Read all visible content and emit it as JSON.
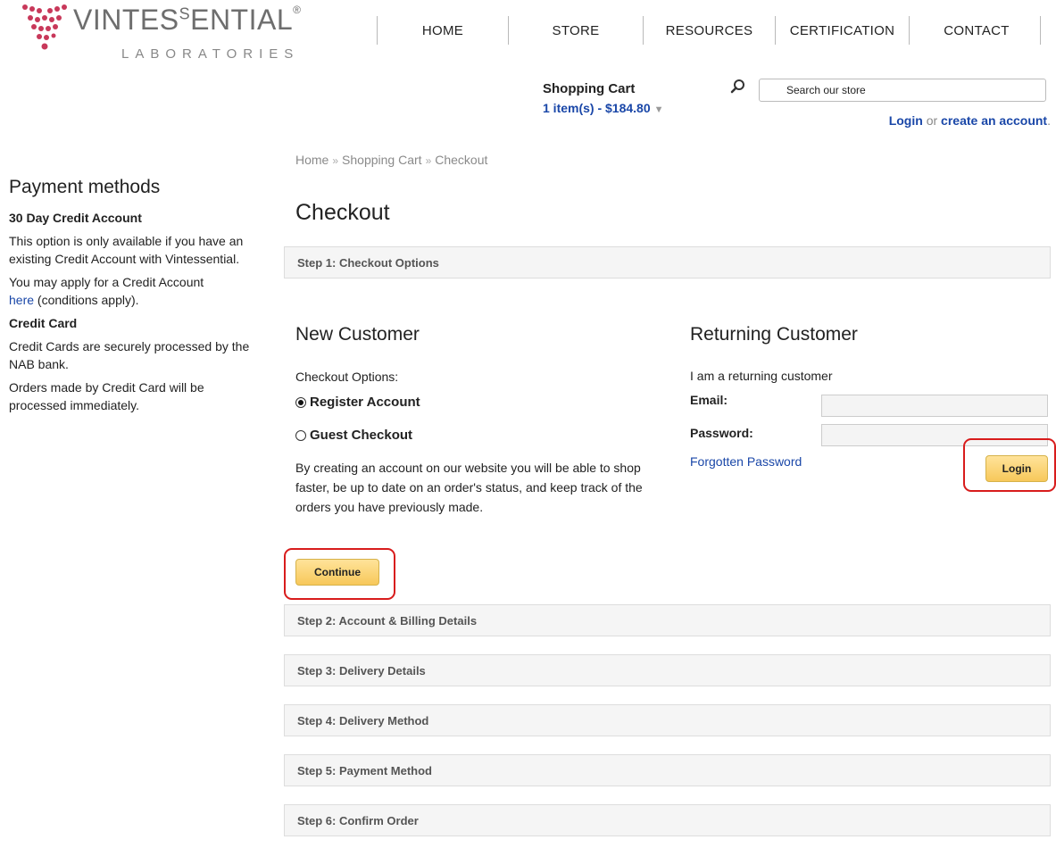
{
  "header": {
    "logo": {
      "word_part1": "VINTES",
      "word_sup": "S",
      "word_part2": "ENTIAL",
      "registered": "®",
      "subtitle": "LABORATORIES"
    },
    "nav": [
      "HOME",
      "STORE",
      "RESOURCES",
      "CERTIFICATION",
      "CONTACT"
    ],
    "cart": {
      "title": "Shopping Cart",
      "summary": "1 item(s) - $184.80",
      "caret": "▼"
    },
    "search": {
      "placeholder": "Search our store"
    },
    "account": {
      "login": "Login",
      "or": "or",
      "create": "create an account",
      "period": "."
    }
  },
  "breadcrumb": [
    "Home",
    "Shopping Cart",
    "Checkout"
  ],
  "breadcrumb_sep": "»",
  "sidebar": {
    "title": "Payment methods",
    "credit_title": "30 Day Credit Account",
    "credit_text": "This option is only available if you have an existing Credit Account with Vintessential.",
    "apply_text_prefix": "You may apply for a Credit Account",
    "apply_link": "here",
    "apply_text_suffix": "(conditions apply).",
    "card_title": "Credit Card",
    "card_text_1": "Credit Cards are securely processed by the NAB bank.",
    "card_text_2": "Orders made by Credit Card will be processed immediately."
  },
  "main": {
    "title": "Checkout",
    "steps": [
      "Step 1: Checkout Options",
      "Step 2: Account & Billing Details",
      "Step 3: Delivery Details",
      "Step 4: Delivery Method",
      "Step 5: Payment Method",
      "Step 6: Confirm Order"
    ],
    "new_customer": {
      "title": "New Customer",
      "options_label": "Checkout Options:",
      "register": "Register Account",
      "guest": "Guest Checkout",
      "selected": "Register Account",
      "description": "By creating an account on our website you will be able to shop faster, be up to date on an order's status, and keep track of the orders you have previously made.",
      "continue": "Continue"
    },
    "returning_customer": {
      "title": "Returning Customer",
      "intro": "I am a returning customer",
      "email_label": "Email:",
      "password_label": "Password:",
      "forgot": "Forgotten Password",
      "login": "Login"
    }
  },
  "colors": {
    "link": "#1a47a8",
    "button": "#f7c85a",
    "highlight": "#d81c1c"
  }
}
